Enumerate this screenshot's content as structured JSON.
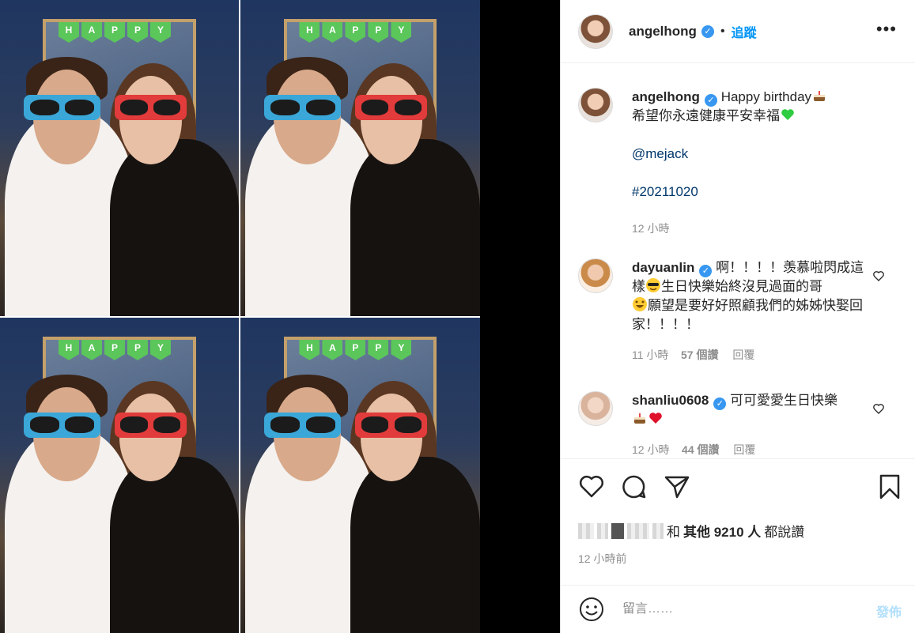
{
  "post": {
    "username": "angelhong",
    "follow_label": "追蹤",
    "more_label": "•••"
  },
  "photo": {
    "banner_letters": [
      "H",
      "A",
      "P",
      "P",
      "Y"
    ]
  },
  "caption": {
    "username": "angelhong",
    "line1": "Happy birthday",
    "line2": "希望你永遠健康平安幸福",
    "mention": "@mejack",
    "hashtag": "#20211020",
    "time": "12 小時"
  },
  "comments": [
    {
      "username": "dayuanlin",
      "text_part1": "啊！！！！羡慕啦閃成這樣",
      "text_part2": "生日快樂始終沒見過面的哥",
      "text_part3": "願望是要好好照顧我們的姊姊快娶回家！！！！",
      "time": "11 小時",
      "likes": "57 個讚",
      "reply": "回覆"
    },
    {
      "username": "shanliu0608",
      "text": "可可愛愛生日快樂",
      "time": "12 小時",
      "likes": "44 個讚",
      "reply": "回覆"
    }
  ],
  "likes_bar": {
    "and": "和",
    "others": "其他 9210 人",
    "suffix": "都說讚",
    "time": "12 小時前"
  },
  "comment_input": {
    "placeholder": "留言……",
    "post_label": "發佈"
  },
  "icons": [
    "heart-icon",
    "comment-icon",
    "share-icon",
    "bookmark-icon",
    "smile-icon",
    "verified-icon",
    "cake-icon",
    "green-heart-icon",
    "sunglasses-icon",
    "laugh-icon",
    "red-heart-icon"
  ],
  "colors": {
    "accent": "#0095f6",
    "verified": "#3897f0",
    "muted": "#8e8e8e"
  }
}
